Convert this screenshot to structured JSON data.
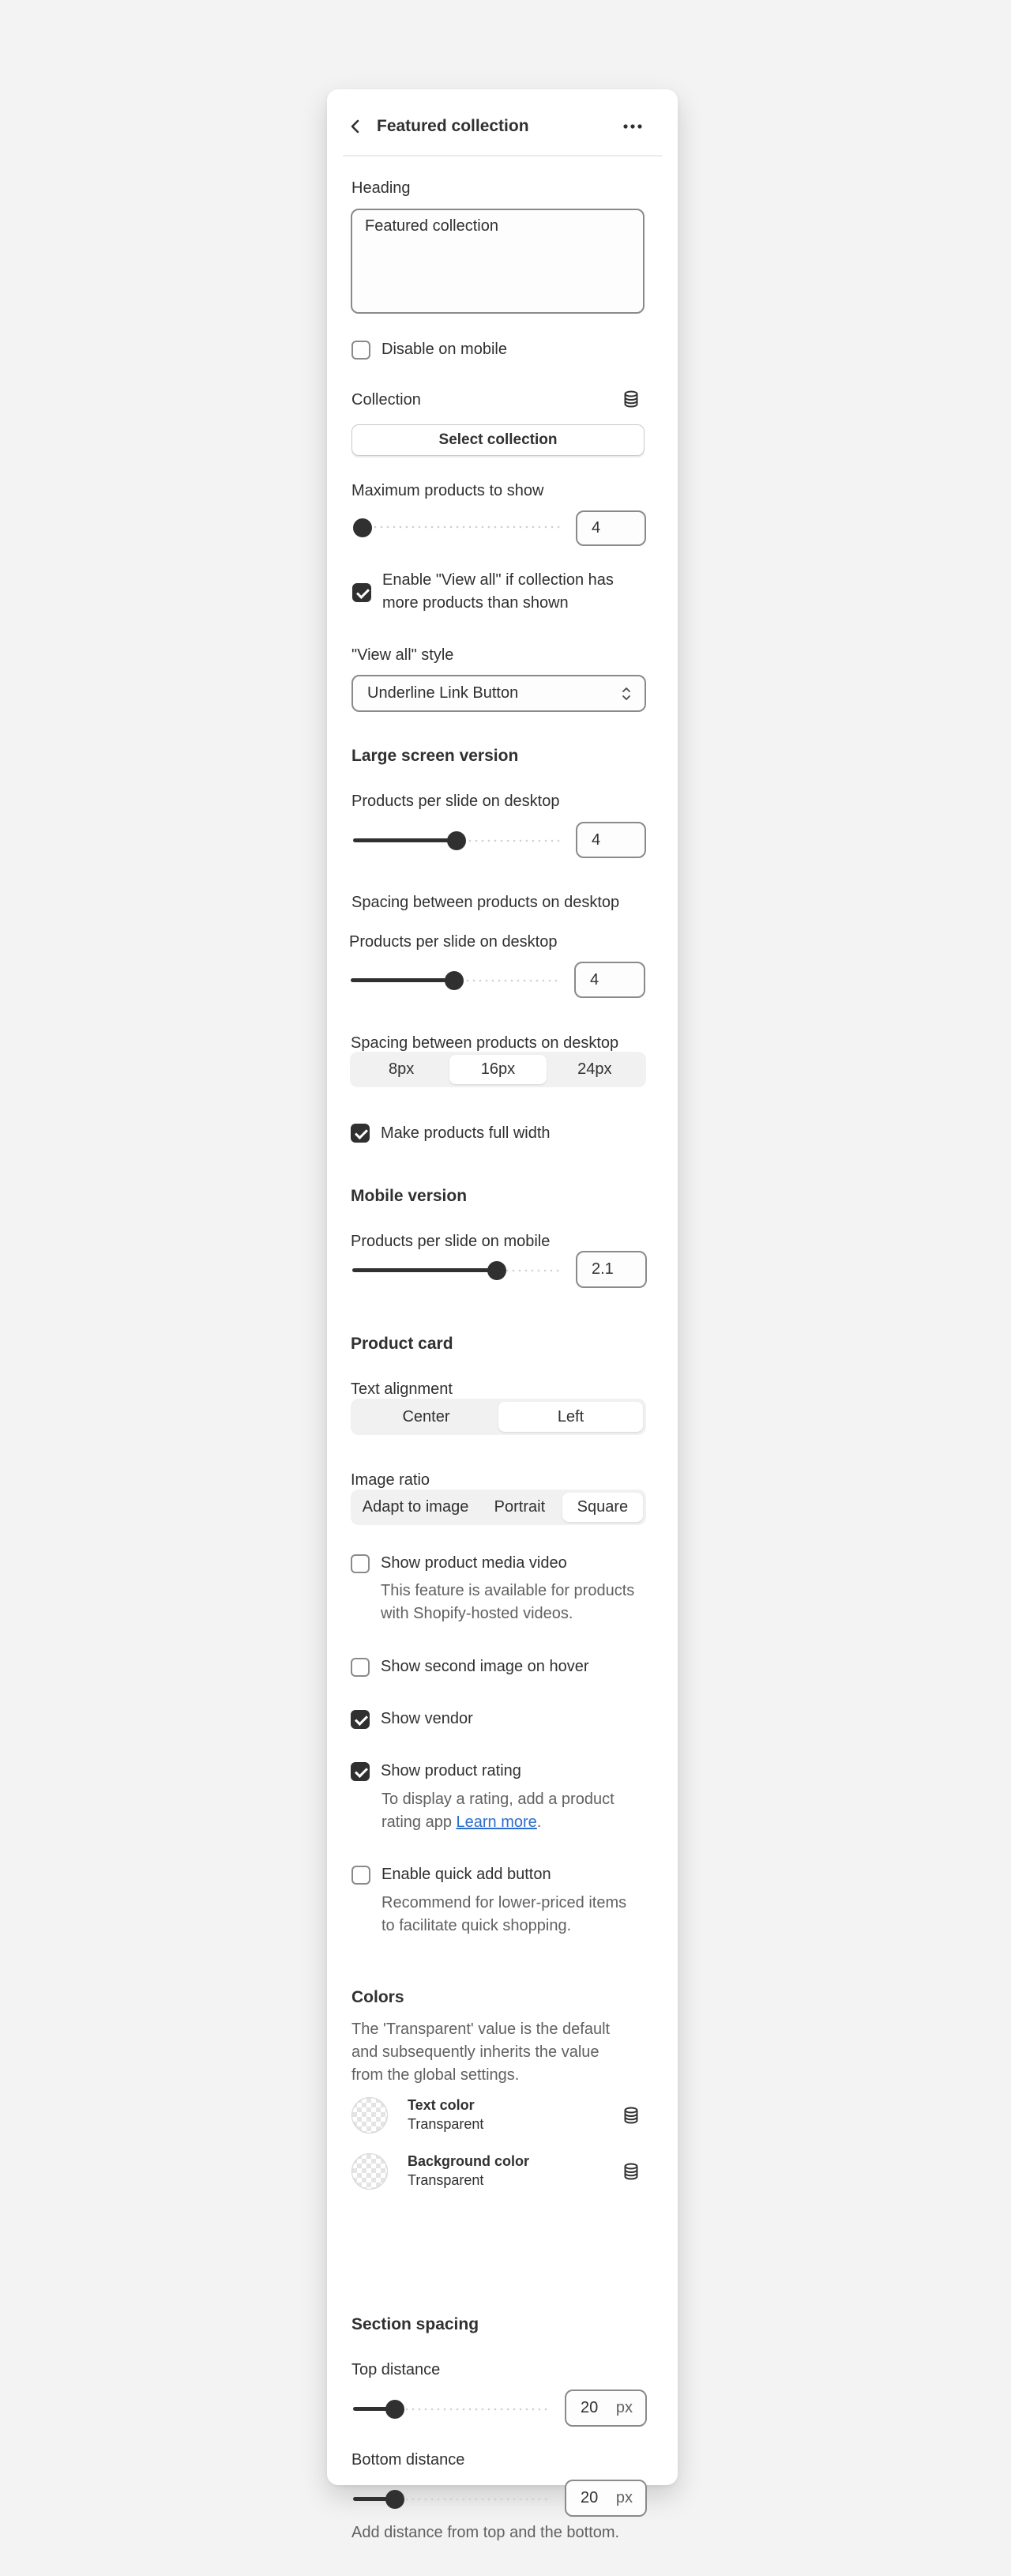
{
  "header": {
    "title": "Featured collection"
  },
  "heading": {
    "label": "Heading",
    "value": "Featured collection"
  },
  "disable_mobile": {
    "label": "Disable on mobile",
    "checked": false
  },
  "collection": {
    "label": "Collection",
    "button": "Select collection"
  },
  "max_products": {
    "label": "Maximum products to show",
    "value": "4",
    "fraction": 0.0
  },
  "view_all": {
    "label_line1": "Enable \"View all\" if collection has",
    "label_line2": "more products than shown",
    "checked": true
  },
  "view_all_style": {
    "label": "\"View all\" style",
    "value": "Underline Link Button"
  },
  "large_screen": {
    "section": "Large screen version",
    "per_slide_label": "Products per slide on desktop",
    "per_slide_value": "4",
    "per_slide_fraction": 0.5,
    "spacing_label": "Spacing between products on desktop",
    "per_slide_label_2": "Products per slide on desktop",
    "per_slide_value_2": "4",
    "spacing_label_2": "Spacing between products on desktop",
    "spacing_options": [
      "8px",
      "16px",
      "24px"
    ],
    "spacing_selected": "16px",
    "full_width_label": "Make products full width",
    "full_width_checked": true
  },
  "mobile": {
    "section": "Mobile version",
    "per_slide_label": "Products per slide on mobile",
    "per_slide_value": "2.1",
    "per_slide_fraction": 0.7
  },
  "product_card": {
    "section": "Product card",
    "text_alignment_label": "Text alignment",
    "text_alignment_options": [
      "Center",
      "Left"
    ],
    "text_alignment_selected": "Left",
    "image_ratio_label": "Image ratio",
    "image_ratio_options": [
      "Adapt to image",
      "Portrait",
      "Square"
    ],
    "image_ratio_selected": "Square",
    "media_video": {
      "label": "Show product media video",
      "help_line1": "This feature is available for products",
      "help_line2": "with Shopify-hosted videos.",
      "checked": false
    },
    "second_image": {
      "label": "Show second image on hover",
      "checked": false
    },
    "vendor": {
      "label": "Show vendor",
      "checked": true
    },
    "rating": {
      "label": "Show product rating",
      "help_line1": "To display a rating, add a product",
      "help_prefix": "rating app ",
      "help_link": "Learn more",
      "help_suffix": ".",
      "checked": true
    },
    "quick_add": {
      "label": "Enable quick add button",
      "help_line1": "Recommend for lower-priced items",
      "help_line2": "to facilitate quick shopping.",
      "checked": false
    }
  },
  "colors": {
    "section": "Colors",
    "desc_line1": "The 'Transparent' value is the default",
    "desc_line2": "and subsequently inherits the value",
    "desc_line3": "from the global settings.",
    "text_color": {
      "label": "Text color",
      "value": "Transparent"
    },
    "background_color": {
      "label": "Background color",
      "value": "Transparent"
    }
  },
  "spacing": {
    "section": "Section spacing",
    "top_label": "Top distance",
    "top_value": "20",
    "bottom_label": "Bottom distance",
    "bottom_value": "20",
    "unit": "px",
    "footer": "Add distance from top and the bottom."
  },
  "theme": {
    "accent": "#303030",
    "link": "#2c6ecb",
    "page_bg": "#f3f3f3"
  }
}
